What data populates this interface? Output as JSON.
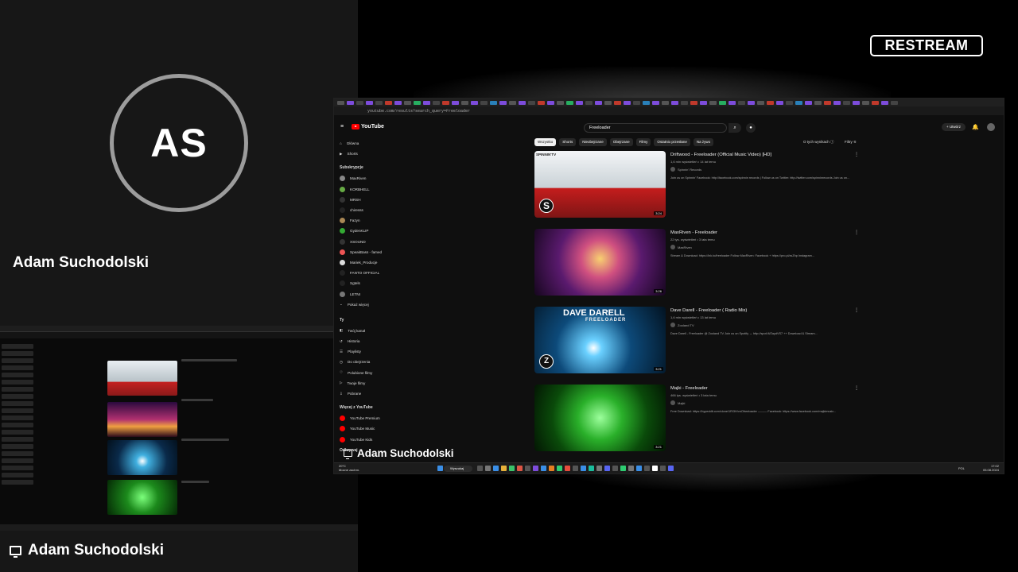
{
  "presenter": {
    "initials": "AS",
    "name": "Adam Suchodolski",
    "screen_label": "Adam Suchodolski"
  },
  "brand": {
    "logo_text": "RESTREAM"
  },
  "browser": {
    "url": "youtube.com/results?search_query=Freeloader"
  },
  "youtube": {
    "logo": "YouTube",
    "search_value": "Freeloader",
    "create_label": "Utwórz",
    "sidebar": {
      "main": [
        "Główna",
        "Shorts"
      ],
      "subs_header": "Subskrypcje",
      "subs": [
        "MaxRiven",
        "KORBHELL",
        "MRSH",
        "chiresss",
        "Fazyn",
        "GydenKLIP",
        "XSOUND",
        "SpeakBass - famed",
        "Mariek_Producje",
        "FANTO OFFICIAL",
        "Sgtels",
        "LETNI",
        "Pokaż więcej"
      ],
      "you_header": "Ty",
      "you": [
        "Twój kanał",
        "Historia",
        "Playlisty",
        "Do obejrzenia",
        "Polubione filmy",
        "Twoje filmy",
        "Pobrane"
      ],
      "more_header": "Więcej z YouTube",
      "more": [
        "YouTube Premium",
        "YouTube Music",
        "YouTube Kids"
      ],
      "explore_header": "Odkrywaj"
    },
    "chips": [
      "Wszystko",
      "Shorts",
      "Nieobejrzane",
      "Obejrzane",
      "Filmy",
      "Ostatnio przesłane",
      "Na żywo"
    ],
    "filter_info": "O tych wynikach",
    "filters": "Filtry",
    "videos": [
      {
        "title": "Driftwood - Freeloader (Official Music Video) [HD]",
        "meta": "1,6 mln wyświetleń • 14 lat temu",
        "channel": "Spinnin' Records",
        "desc": "Join us on Spinnin' Facebook: http://facebook.com/spinnin records | Follow us on Twitter: http://twitter.com/spinninrecords Join us on...",
        "duration": "3:24"
      },
      {
        "title": "MaxRiven - Freeloader",
        "meta": "22 tys. wyświetleń • 3 lata temu",
        "channel": "MaxRiven",
        "desc": "Stream & Download: https://lnk.to/freeloader Follow MaxRiven: Facebook + https://pro.pl/zsZhp Instagram...",
        "duration": "3:26"
      },
      {
        "title": "Dave Darell - Freeloader ( Radio Mix)",
        "meta": "1,6 mln wyświetleń • 13 lat temu",
        "channel": "Zooland TV",
        "desc": "Dave Darell - Freeloader @ Zooland TV Join us on Spotify → http://spoti.fi/ZaydVS7 ++ Download & Stream...",
        "duration": "3:21"
      },
      {
        "title": "Majki - Freeloader",
        "meta": "466 tys. wyświetleń • 3 lata temu",
        "channel": "Majki",
        "desc": "Free Download: https://hypeddit.com/clone/1R/3H/vnOfreeloader ——— Facebook: https://www.facebook.com/majkimusic...",
        "duration": "3:21"
      }
    ],
    "thumb_texts": {
      "spinnin": "SPINNIN'TV",
      "dave": "DAVE DARELL",
      "freeloader": "FREELOADER"
    }
  },
  "taskbar": {
    "weather_temp": "20°C",
    "weather_desc": "Mocne zachm.",
    "search": "Wyszukaj",
    "lang": "POL",
    "time": "17:02",
    "date": "05.08.2024"
  },
  "colors": {
    "accent": "#ff0000",
    "left_bg": "#171717",
    "ring": "#9c9c9c"
  }
}
